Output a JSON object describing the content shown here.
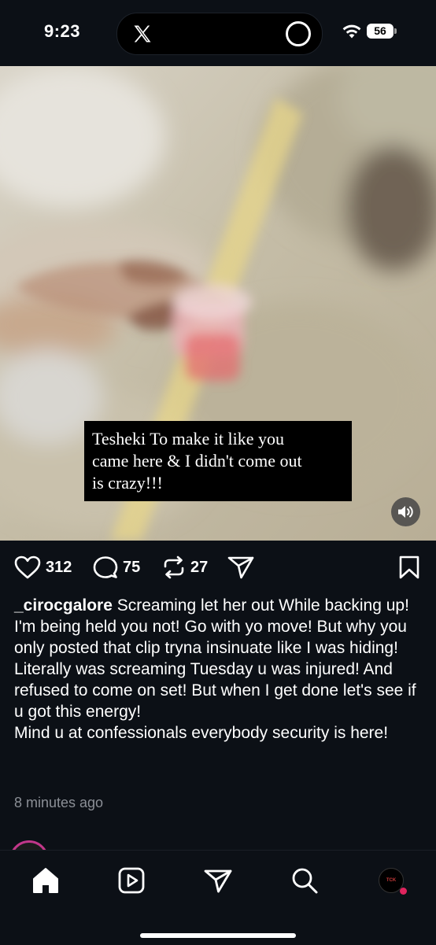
{
  "status_bar": {
    "time": "9:23",
    "battery": "56"
  },
  "media": {
    "caption_text": "Tesheki To make it like you\ncame here & I didn't come out\nis crazy!!!",
    "mute_icon": "speaker-icon"
  },
  "actions": {
    "likes": "312",
    "comments": "75",
    "reposts": "27",
    "icons": [
      "heart-icon",
      "comment-icon",
      "repost-icon",
      "share-icon",
      "bookmark-icon"
    ]
  },
  "post": {
    "username": "_cirocgalore",
    "lines": [
      "Screaming let her out While backing up! I'm being held you not! Go with yo move! But why you only posted that  clip tryna insinuate like I was hiding!",
      "Literally was screaming Tuesday u was injured! And refused to come on set! But when I get done let's see if u got this energy!",
      "Mind u at confessionals everybody security is here!"
    ],
    "timestamp": "8 minutes ago"
  },
  "bottom_nav": {
    "items": [
      "home-icon",
      "video-icon",
      "messages-icon",
      "search-icon",
      "profile-avatar"
    ],
    "profile_badge_text": "TCK"
  },
  "colors": {
    "background": "#0c1016",
    "secondary_text": "#8b8f96",
    "notification_dot": "#e0245e",
    "story_ring": "#c2378a"
  }
}
